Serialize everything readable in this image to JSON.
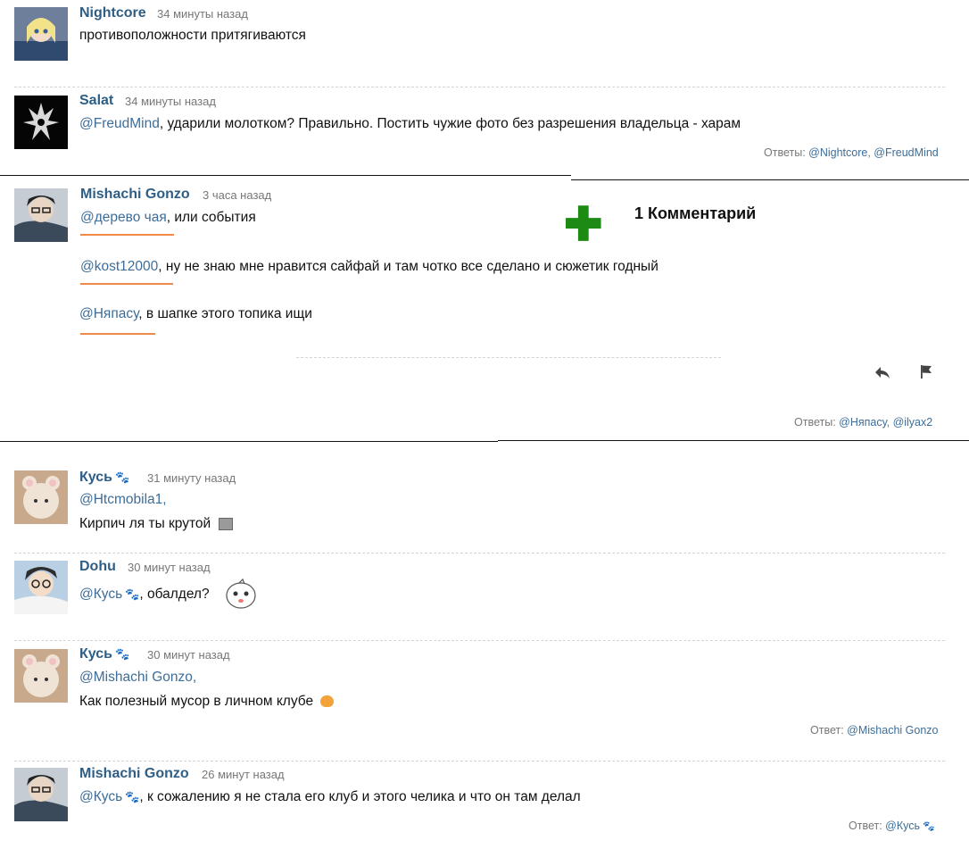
{
  "comments": [
    {
      "user": "Nightcore",
      "time": "34 минуты назад",
      "text": "противоположности притягиваются"
    },
    {
      "user": "Salat",
      "time": "34 минуты назад",
      "mention": "@FreudMind",
      "text": ", ударили молотком? Правильно. Постить чужие фото без разрешения владельца - харам",
      "replies_label": "Ответы: ",
      "replies": [
        "@Nightcore",
        "@FreudMind"
      ]
    },
    {
      "user": "Mishachi Gonzo",
      "time": "3 часа назад",
      "lines": [
        {
          "mention": "@дерево чая",
          "text": ", или события"
        },
        {
          "mention": "@kost12000",
          "text": ", ну не знаю мне нравится сайфай и там чотко все сделано и сюжетик годный"
        },
        {
          "mention": "@Няпасу",
          "text": ", в шапке этого топика ищи"
        }
      ],
      "replies_label": "Ответы: ",
      "replies": [
        "@Няпасу",
        "@ilyax2"
      ]
    },
    {
      "user": "Кусь",
      "paw": "🐾",
      "time": "31 минуту назад",
      "mention": "@Htcmobila1,",
      "text": "Кирпич ля ты крутой"
    },
    {
      "user": "Dohu",
      "time": "30 минут назад",
      "mention": "@Кусь",
      "text": ", обалдел?"
    },
    {
      "user": "Кусь",
      "paw": "🐾",
      "time": "30 минут назад",
      "mention": "@Mishachi Gonzo,",
      "text": "Как полезный мусор в личном клубе",
      "reply_label": "Ответ: ",
      "reply": "@Mishachi Gonzo"
    },
    {
      "user": "Mishachi Gonzo",
      "time": "26 минут назад",
      "mention": "@Кусь",
      "text": ", к сожалению я не стала его клуб и этого челика и что он там делал",
      "reply_label": "Ответ: ",
      "reply": "@Кусь"
    }
  ],
  "overlay": {
    "plus": "✚",
    "count_label": "1 Комментарий"
  },
  "icons": {
    "reply": "reply-icon",
    "flag": "flag-icon",
    "paw": "paw-icon"
  },
  "colors": {
    "username": "#2e5e86",
    "mention": "#3d6d99",
    "plus": "#1d8a14",
    "underline": "#f0894a"
  }
}
